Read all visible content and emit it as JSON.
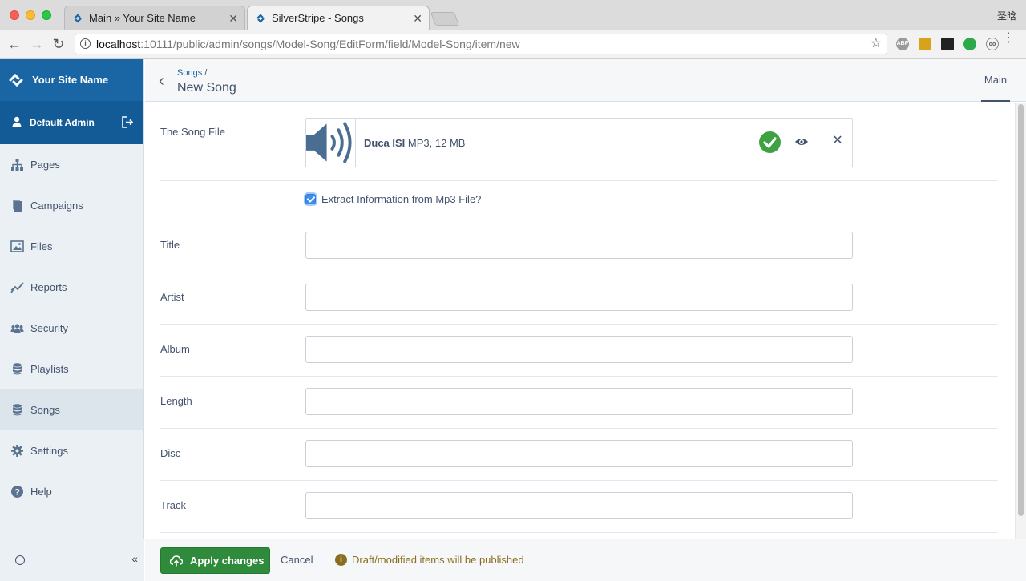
{
  "browser": {
    "tabs": [
      {
        "title": "Main » Your Site Name",
        "active": false
      },
      {
        "title": "SilverStripe - Songs",
        "active": true
      }
    ],
    "profile_name": "圣晗",
    "url_host": "localhost",
    "url_rest": ":10111/public/admin/songs/Model-Song/EditForm/field/Model-Song/item/new"
  },
  "sidebar": {
    "site_name": "Your Site Name",
    "user_name": "Default Admin",
    "items": [
      {
        "label": "Pages",
        "icon": "sitemap-icon"
      },
      {
        "label": "Campaigns",
        "icon": "campaigns-icon"
      },
      {
        "label": "Files",
        "icon": "image-icon"
      },
      {
        "label": "Reports",
        "icon": "chart-line-icon"
      },
      {
        "label": "Security",
        "icon": "users-icon"
      },
      {
        "label": "Playlists",
        "icon": "database-icon"
      },
      {
        "label": "Songs",
        "icon": "database-icon",
        "active": true
      },
      {
        "label": "Settings",
        "icon": "gear-icon"
      },
      {
        "label": "Help",
        "icon": "help-icon"
      }
    ],
    "collapse_label": "«"
  },
  "header": {
    "breadcrumb_link": "Songs",
    "breadcrumb_sep": "/",
    "title": "New Song",
    "tab_main": "Main"
  },
  "form": {
    "song_file_label": "The Song File",
    "file_name": "Duca ISI",
    "file_meta": "MP3, 12 MB",
    "extract_label": "Extract Information from Mp3 File?",
    "extract_checked": true,
    "fields": [
      {
        "label": "Title",
        "value": ""
      },
      {
        "label": "Artist",
        "value": ""
      },
      {
        "label": "Album",
        "value": ""
      },
      {
        "label": "Length",
        "value": ""
      },
      {
        "label": "Disc",
        "value": ""
      },
      {
        "label": "Track",
        "value": ""
      }
    ]
  },
  "footer": {
    "apply_label": "Apply changes",
    "cancel_label": "Cancel",
    "notice": "Draft/modified items will be published"
  },
  "colors": {
    "brand_blue": "#1a65a3",
    "apply_green": "#2f8b3b",
    "success_green": "#3fa142",
    "notice_brown": "#8a6d1e"
  }
}
